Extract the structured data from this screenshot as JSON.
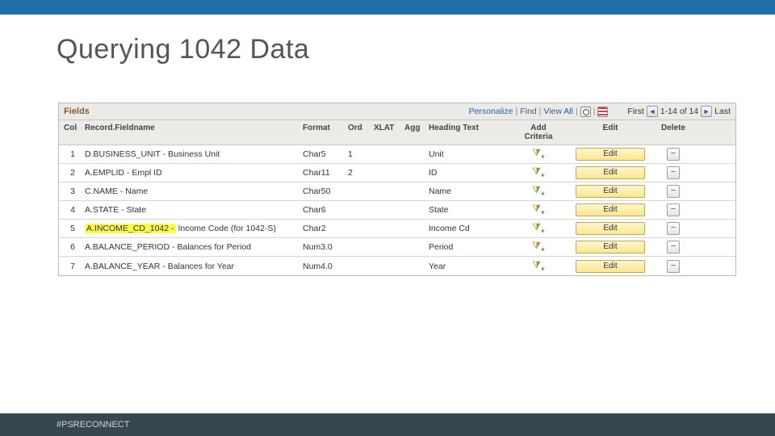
{
  "slide": {
    "title": "Querying 1042 Data",
    "footer_tag": "#PSRECONNECT"
  },
  "panel": {
    "title": "Fields",
    "toolbar": {
      "personalize": "Personalize",
      "find": "Find",
      "viewall": "View All",
      "nav_first_label": "First",
      "nav_last_label": "Last",
      "range": "1-14 of 14"
    },
    "columns": {
      "col": "Col",
      "field": "Record.Fieldname",
      "format": "Format",
      "ord": "Ord",
      "xlat": "XLAT",
      "agg": "Agg",
      "heading": "Heading Text",
      "addcrit": "Add Criteria",
      "edit": "Edit",
      "delete": "Delete"
    },
    "edit_label": "Edit",
    "rows": [
      {
        "n": "1",
        "field": "D.BUSINESS_UNIT - Business Unit",
        "fmt": "Char5",
        "ord": "1",
        "heading": "Unit",
        "hl": false
      },
      {
        "n": "2",
        "field": "A.EMPLID - Empl ID",
        "fmt": "Char11",
        "ord": "2",
        "heading": "ID",
        "hl": false
      },
      {
        "n": "3",
        "field": "C.NAME - Name",
        "fmt": "Char50",
        "ord": "",
        "heading": "Name",
        "hl": false
      },
      {
        "n": "4",
        "field": "A.STATE - State",
        "fmt": "Char6",
        "ord": "",
        "heading": "State",
        "hl": false
      },
      {
        "n": "5",
        "field": "A.INCOME_CD_1042 - Income Code (for 1042-S)",
        "fmt": "Char2",
        "ord": "",
        "heading": "Income Cd",
        "hl": true,
        "hl_prefix": "A.INCOME_CD_1042 -",
        "hl_rest": " Income Code (for 1042-S)"
      },
      {
        "n": "6",
        "field": "A.BALANCE_PERIOD - Balances for Period",
        "fmt": "Num3.0",
        "ord": "",
        "heading": "Period",
        "hl": false
      },
      {
        "n": "7",
        "field": "A.BALANCE_YEAR - Balances for Year",
        "fmt": "Num4.0",
        "ord": "",
        "heading": "Year",
        "hl": false
      }
    ]
  }
}
